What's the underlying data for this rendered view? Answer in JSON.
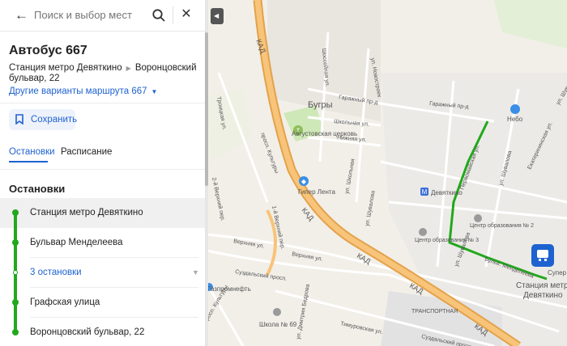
{
  "search": {
    "placeholder": "Поиск и выбор мест"
  },
  "route": {
    "title": "Автобус 667",
    "from": "Станция метро Девяткино",
    "to": "Воронцовский бульвар, 22",
    "variants_label": "Другие варианты маршрута 667"
  },
  "actions": {
    "save_label": "Сохранить"
  },
  "tabs": [
    {
      "label": "Остановки",
      "active": true
    },
    {
      "label": "Расписание",
      "active": false
    }
  ],
  "stops": {
    "heading": "Остановки",
    "items": [
      {
        "label": "Станция метро Девяткино"
      },
      {
        "label": "Бульвар Менделеева"
      },
      {
        "label": "3 остановки",
        "collapsed": true
      },
      {
        "label": "Графская улица"
      },
      {
        "label": "Воронцовский бульвар, 22"
      }
    ]
  },
  "map": {
    "roads": {
      "kad": "КАД",
      "garage_1": "Гаражный пр-д",
      "garage_2": "Гаражный пр-д",
      "shkolnaya": "Школьная ул.",
      "nizhnyaya": "Нижняя ул.",
      "shosseynaya": "Шоссейная ул.",
      "novostroy": "ул. Новостроек",
      "verkhnyaya": "Верхняя ул.",
      "verkhnyaya_2": "Верхняя ул.",
      "verkhniy_2": "2-й Верхний пер.",
      "verkhniy_1": "1-й Верхний пер.",
      "suzdal": "Суздальский просп.",
      "suzdal_2": "Суздальский просп.",
      "timurovskaya": "Тимуровская ул.",
      "kultury_1": "просп. Культуры",
      "kultury_2": "просп. Культуры",
      "troitskaya": "Троицкая ул.",
      "shuvalova": "ул. Шувалова",
      "shuvalova_2": "ул. Шувалова",
      "shuvalova_3": "ул. Шувалова",
      "shuvalova_4": "ул. Шувалова",
      "shkolnaya_2": "ул. Школьная",
      "ekaterininskaya": "Екатерининская ул.",
      "mendeleeva": "Бульв. Менделеева",
      "dmitriya_bedrova": "ул. Дмитрия Бедрова",
      "transport": "ТРАНСПОРТНАЯ",
      "pervomayskaya": "Первомайская ул."
    },
    "places": {
      "bugry": "Бугры",
      "church": "Августовская церковь",
      "giper_lenta": "Гипер Лента",
      "devyatkino": "Девяткино",
      "centr_3": "Центр образования № 3",
      "centr_2": "Центр образования № 2",
      "gazprom": "Газпромнефть",
      "shkola_69": "Школа № 69",
      "nebo": "Небо",
      "super": "Супер",
      "metro_stop": "Станция метро Девяткино"
    },
    "colors": {
      "route": "#22a81d",
      "kad": "#f4b55e",
      "accent": "#1e62d0"
    }
  }
}
